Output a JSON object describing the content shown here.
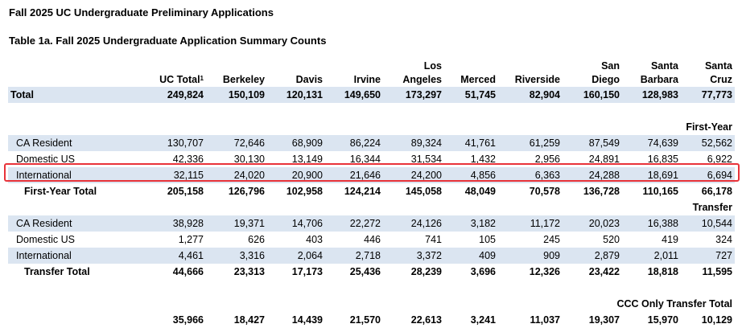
{
  "document": {
    "title": "Fall 2025 UC Undergraduate Preliminary Applications",
    "subtitle": "Table 1a. Fall 2025 Undergraduate Application Summary Counts"
  },
  "columns": [
    {
      "line1": "",
      "line2": "UC Total",
      "sup": "1"
    },
    {
      "line1": "",
      "line2": "Berkeley"
    },
    {
      "line1": "",
      "line2": "Davis"
    },
    {
      "line1": "",
      "line2": "Irvine"
    },
    {
      "line1": "Los",
      "line2": "Angeles"
    },
    {
      "line1": "",
      "line2": "Merced"
    },
    {
      "line1": "",
      "line2": "Riverside"
    },
    {
      "line1": "San",
      "line2": "Diego"
    },
    {
      "line1": "Santa",
      "line2": "Barbara"
    },
    {
      "line1": "Santa",
      "line2": "Cruz"
    }
  ],
  "total_row": {
    "label": "Total",
    "values": [
      "249,824",
      "150,109",
      "120,131",
      "149,650",
      "173,297",
      "51,745",
      "82,904",
      "160,150",
      "128,983",
      "77,773"
    ]
  },
  "first_year": {
    "heading": "First-Year",
    "rows": [
      {
        "label": "CA Resident",
        "values": [
          "130,707",
          "72,646",
          "68,909",
          "86,224",
          "89,324",
          "41,761",
          "61,259",
          "87,549",
          "74,639",
          "52,562"
        ]
      },
      {
        "label": "Domestic US",
        "values": [
          "42,336",
          "30,130",
          "13,149",
          "16,344",
          "31,534",
          "1,432",
          "2,956",
          "24,891",
          "16,835",
          "6,922"
        ]
      },
      {
        "label": "International",
        "values": [
          "32,115",
          "24,020",
          "20,900",
          "21,646",
          "24,200",
          "4,856",
          "6,363",
          "24,288",
          "18,691",
          "6,694"
        ]
      }
    ],
    "total": {
      "label": "First-Year Total",
      "values": [
        "205,158",
        "126,796",
        "102,958",
        "124,214",
        "145,058",
        "48,049",
        "70,578",
        "136,728",
        "110,165",
        "66,178"
      ]
    }
  },
  "transfer": {
    "heading": "Transfer",
    "rows": [
      {
        "label": "CA Resident",
        "values": [
          "38,928",
          "19,371",
          "14,706",
          "22,272",
          "24,126",
          "3,182",
          "11,172",
          "20,023",
          "16,388",
          "10,544"
        ]
      },
      {
        "label": "Domestic US",
        "values": [
          "1,277",
          "626",
          "403",
          "446",
          "741",
          "105",
          "245",
          "520",
          "419",
          "324"
        ]
      },
      {
        "label": "International",
        "values": [
          "4,461",
          "3,316",
          "2,064",
          "2,718",
          "3,372",
          "409",
          "909",
          "2,879",
          "2,011",
          "727"
        ]
      }
    ],
    "total": {
      "label": "Transfer Total",
      "values": [
        "44,666",
        "23,313",
        "17,173",
        "25,436",
        "28,239",
        "3,696",
        "12,326",
        "23,422",
        "18,818",
        "11,595"
      ]
    }
  },
  "ccc_transfer": {
    "heading": "CCC Only Transfer Total",
    "values": [
      "35,966",
      "18,427",
      "14,439",
      "21,570",
      "22,613",
      "3,241",
      "11,037",
      "19,307",
      "15,970",
      "10,129"
    ]
  },
  "highlight_color": "#e8333a",
  "row_shade_color": "#dbe5f1"
}
